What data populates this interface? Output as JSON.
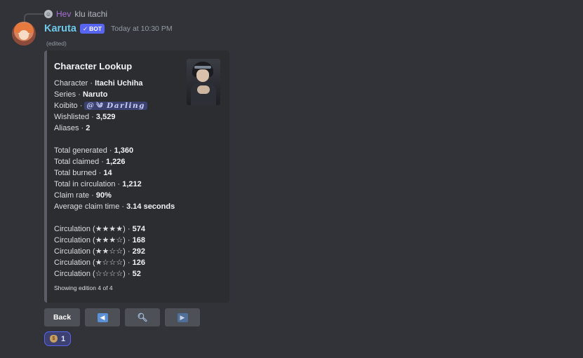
{
  "reply": {
    "user": "Hev",
    "text": "klu itachi"
  },
  "message": {
    "username": "Karuta",
    "bot_tag": "BOT",
    "timestamp": "Today at 10:30 PM",
    "edited": "(edited)"
  },
  "embed": {
    "title": "Character Lookup",
    "details": [
      {
        "label": "Character · ",
        "value": "Itachi Uchiha"
      },
      {
        "label": "Series · ",
        "value": "Naruto"
      },
      {
        "label": "Wishlisted · ",
        "value": "3,529"
      },
      {
        "label": "Aliases · ",
        "value": "2"
      }
    ],
    "koibito": {
      "label": "Koibito · ",
      "mention": "@༄ Darling"
    },
    "stats": [
      {
        "label": "Total generated · ",
        "value": "1,360"
      },
      {
        "label": "Total claimed · ",
        "value": "1,226"
      },
      {
        "label": "Total burned · ",
        "value": "14"
      },
      {
        "label": "Total in circulation · ",
        "value": "1,212"
      },
      {
        "label": "Claim rate · ",
        "value": "90%"
      },
      {
        "label": "Average claim time · ",
        "value": "3.14 seconds"
      }
    ],
    "circulation": [
      {
        "label": "Circulation ",
        "stars": "(★★★★)",
        "sep": " · ",
        "value": "574"
      },
      {
        "label": "Circulation ",
        "stars": "(★★★☆)",
        "sep": " · ",
        "value": "168"
      },
      {
        "label": "Circulation ",
        "stars": "(★★☆☆)",
        "sep": " · ",
        "value": "292"
      },
      {
        "label": "Circulation ",
        "stars": "(★☆☆☆)",
        "sep": " · ",
        "value": "126"
      },
      {
        "label": "Circulation ",
        "stars": "(☆☆☆☆)",
        "sep": " · ",
        "value": "52"
      }
    ],
    "footer": "Showing edition 4 of 4"
  },
  "buttons": {
    "back": "Back",
    "left_icon": "left-arrow-icon",
    "search_icon": "search-icon",
    "right_icon": "right-arrow-icon"
  },
  "reaction": {
    "icon": "money-bag-icon",
    "count": "1"
  },
  "colors": {
    "background": "#313338",
    "embed_background": "#2b2d31",
    "username": "#6ec9e8",
    "bot_tag": "#5865f2",
    "reply_user": "#a970d6"
  }
}
